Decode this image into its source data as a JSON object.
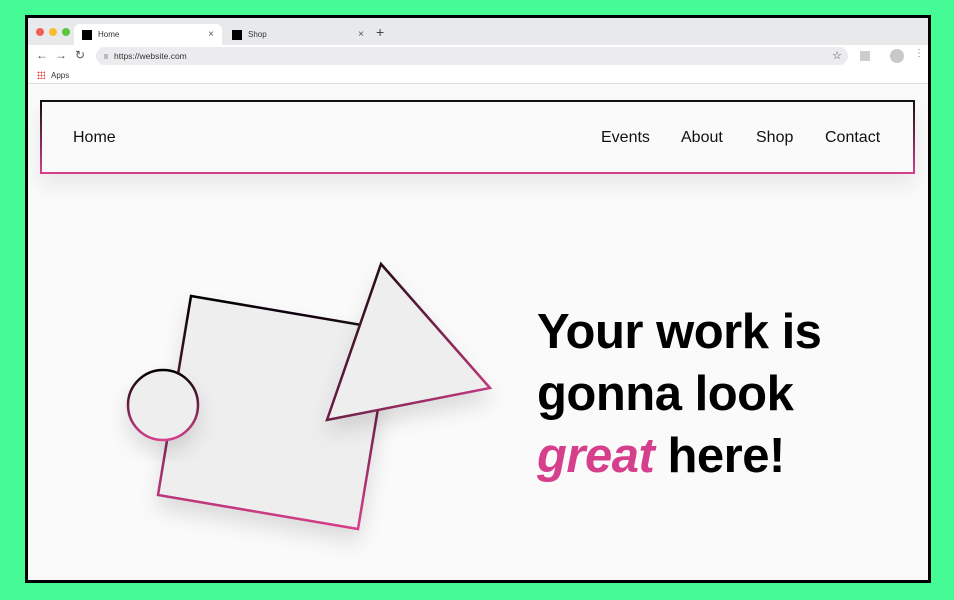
{
  "browser": {
    "tabs": [
      {
        "title": "Home",
        "active": true
      },
      {
        "title": "Shop",
        "active": false
      }
    ],
    "url": "https://website.com",
    "bookmarks": [
      {
        "label": "Apps",
        "icon": "apps-grid-icon"
      }
    ],
    "controls": {
      "close": "×",
      "new_tab": "+",
      "back": "←",
      "forward": "→",
      "reload": "↻",
      "star": "☆",
      "menu": "⋮"
    }
  },
  "nav": {
    "home": "Home",
    "links": [
      "Events",
      "About",
      "Shop",
      "Contact"
    ]
  },
  "hero": {
    "line1": "Your work is",
    "line2": "gonna look",
    "emphasis": "great",
    "line3_rest": " here!"
  },
  "colors": {
    "accent": "#d63f8c",
    "background": "#45fb96"
  }
}
